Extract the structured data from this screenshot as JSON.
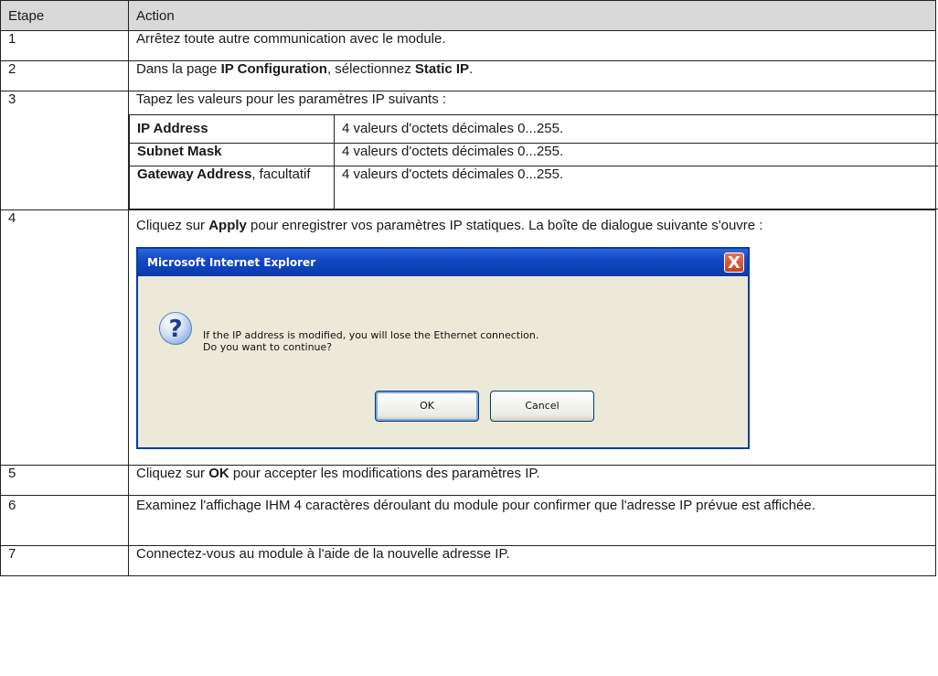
{
  "header": {
    "step": "Etape",
    "action": "Action"
  },
  "rows": [
    {
      "step": "1",
      "parts": [
        {
          "t": "Arrêtez toute autre communication avec le module."
        }
      ]
    },
    {
      "step": "2",
      "parts": [
        {
          "t": "Dans la page "
        },
        {
          "t": "IP Configuration",
          "b": true
        },
        {
          "t": ", sélectionnez "
        },
        {
          "t": "Static IP",
          "b": true
        },
        {
          "t": "."
        }
      ]
    },
    {
      "step": "3",
      "intro": "Tapez les valeurs pour les paramètres IP suivants :",
      "params": [
        {
          "name": "IP Address",
          "suffix": "",
          "value": "4 valeurs d'octets décimales 0...255."
        },
        {
          "name": "Subnet Mask",
          "suffix": "",
          "value": "4 valeurs d'octets décimales 0...255."
        },
        {
          "name": "Gateway Address",
          "suffix": ", facultatif",
          "value": "4 valeurs d'octets décimales 0...255."
        }
      ]
    },
    {
      "step": "4",
      "parts": [
        {
          "t": "Cliquez sur "
        },
        {
          "t": "Apply",
          "b": true
        },
        {
          "t": " pour enregistrer vos paramètres IP statiques. La boîte de dialogue suivante s'ouvre :"
        }
      ]
    },
    {
      "step": "5",
      "parts": [
        {
          "t": "Cliquez sur "
        },
        {
          "t": "OK",
          "b": true
        },
        {
          "t": " pour accepter les modifications des paramètres IP."
        }
      ]
    },
    {
      "step": "6",
      "parts": [
        {
          "t": "Examinez l'affichage IHM 4 caractères déroulant du module pour confirmer que l'adresse IP prévue est affichée."
        }
      ]
    },
    {
      "step": "7",
      "parts": [
        {
          "t": "Connectez-vous au module à l'aide de la nouvelle adresse IP."
        }
      ]
    }
  ],
  "dialog": {
    "title": "Microsoft Internet Explorer",
    "close_glyph": "X",
    "icon_glyph": "?",
    "message_line1": "If the IP address is modified, you will lose the Ethernet connection.",
    "message_line2": "Do you want to continue?",
    "ok_label": "OK",
    "cancel_label": "Cancel"
  }
}
